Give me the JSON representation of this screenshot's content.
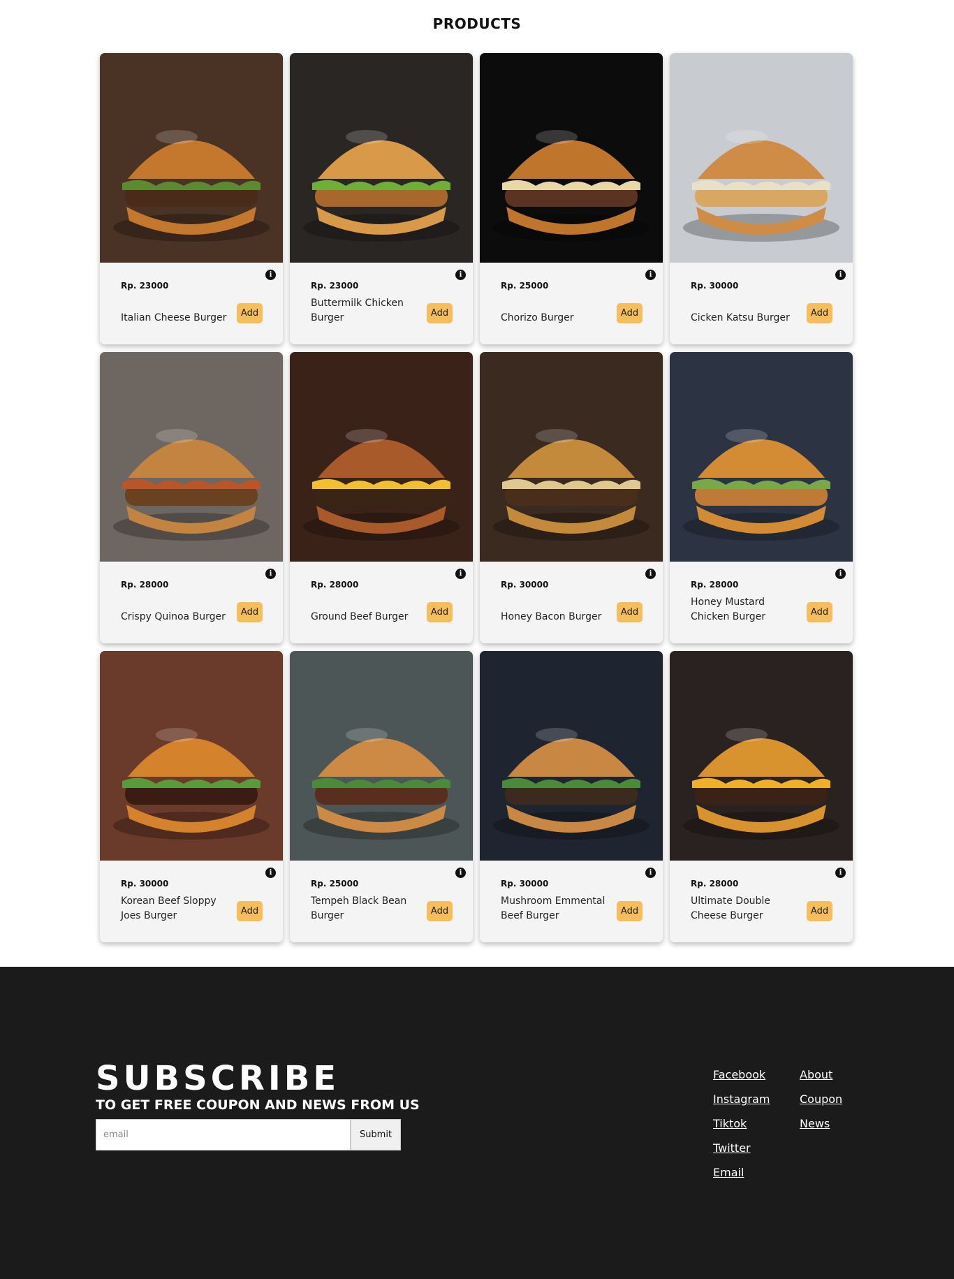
{
  "products_title": "PRODUCTS",
  "products": [
    {
      "price": "Rp. 23000",
      "name": "Italian Cheese Burger",
      "add_label": "Add",
      "bg": "#4a3224",
      "bun": "#c4782e",
      "patty": "#4a2a18",
      "veg": "#5c8a2e"
    },
    {
      "price": "Rp. 23000",
      "name": "Buttermilk Chicken Burger",
      "add_label": "Add",
      "bg": "#2a2624",
      "bun": "#d89a48",
      "patty": "#a8682c",
      "veg": "#6fae38"
    },
    {
      "price": "Rp. 25000",
      "name": "Chorizo Burger",
      "add_label": "Add",
      "bg": "#0c0c0c",
      "bun": "#c0752c",
      "patty": "#5a3420",
      "veg": "#e8d8a8"
    },
    {
      "price": "Rp. 30000",
      "name": "Cicken Katsu Burger",
      "add_label": "Add",
      "bg": "#c8ccd0",
      "bun": "#cf8c46",
      "patty": "#d8a862",
      "veg": "#e8e0c8"
    },
    {
      "price": "Rp. 28000",
      "name": "Crispy Quinoa Burger",
      "add_label": "Add",
      "bg": "#6e6660",
      "bun": "#c28440",
      "patty": "#6a4222",
      "veg": "#b8562a"
    },
    {
      "price": "Rp. 28000",
      "name": "Ground Beef Burger",
      "add_label": "Add",
      "bg": "#3a2218",
      "bun": "#a85a2a",
      "patty": "#3a2416",
      "veg": "#f0c030"
    },
    {
      "price": "Rp. 30000",
      "name": "Honey Bacon Burger",
      "add_label": "Add",
      "bg": "#3a2a20",
      "bun": "#c48a3c",
      "patty": "#4a2e1c",
      "veg": "#e0c890"
    },
    {
      "price": "Rp. 28000",
      "name": "Honey Mustard Chicken Burger",
      "add_label": "Add",
      "bg": "#2c3444",
      "bun": "#d48c34",
      "patty": "#c07a38",
      "veg": "#7aa848"
    },
    {
      "price": "Rp. 30000",
      "name": "Korean Beef Sloppy Joes Burger",
      "add_label": "Add",
      "bg": "#6a3a2a",
      "bun": "#d4822c",
      "patty": "#3a1c12",
      "veg": "#5a9a3a"
    },
    {
      "price": "Rp. 25000",
      "name": "Tempeh Black Bean Burger",
      "add_label": "Add",
      "bg": "#4c5656",
      "bun": "#cc8a44",
      "patty": "#5a2e1e",
      "veg": "#4a8a3a"
    },
    {
      "price": "Rp. 30000",
      "name": "Mushroom Emmental Beef Burger",
      "add_label": "Add",
      "bg": "#1e2430",
      "bun": "#c88844",
      "patty": "#3c2a1e",
      "veg": "#4a8a3a"
    },
    {
      "price": "Rp. 28000",
      "name": "Ultimate Double Cheese Burger",
      "add_label": "Add",
      "bg": "#2a2220",
      "bun": "#d8922e",
      "patty": "#3a2216",
      "veg": "#f0b028"
    }
  ],
  "subscribe": {
    "title": "SUBSCRIBE",
    "subtitle": "TO GET FREE COUPON AND NEWS FROM US",
    "email_placeholder": "email",
    "submit_label": "Submit"
  },
  "footer_links": {
    "col1": [
      "Facebook",
      "Instagram",
      "Tiktok",
      "Twitter",
      "Email"
    ],
    "col2": [
      "About",
      "Coupon",
      "News"
    ]
  }
}
